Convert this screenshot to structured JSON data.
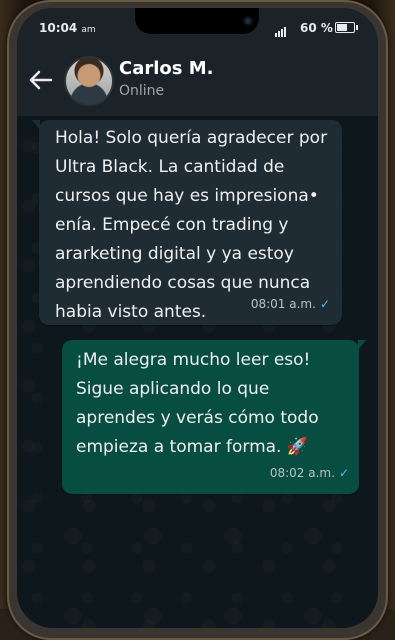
{
  "status_bar": {
    "time": "10:04",
    "time_suffix": "am",
    "battery_percent": "60 %",
    "battery_level": 0.6
  },
  "header": {
    "contact_name": "Carlos M.",
    "contact_status": "Online",
    "back_icon": "arrow-left-icon",
    "avatar": "avatar"
  },
  "messages": [
    {
      "direction": "incoming",
      "text": "Hola! Solo quería agradecer por Ultra Black. La cantidad de cursos que hay es impresiona• enía. Empecé con trading y ararketing digital y ya estoy aprendiendo cosas que nunca habia visto antes.",
      "time": "08:01 a.m.",
      "check": "✓"
    },
    {
      "direction": "outgoing",
      "text": "¡Me alegra mucho leer eso! Sigue aplicando lo que aprendes y verás cómo todo empieza a tomar forma. 🚀",
      "time": "08:02 a.m.",
      "check": "✓"
    }
  ],
  "colors": {
    "incoming_bubble": "#1f2c33",
    "outgoing_bubble": "#084d42",
    "header": "#1b2328",
    "check": "#53bdeb"
  }
}
